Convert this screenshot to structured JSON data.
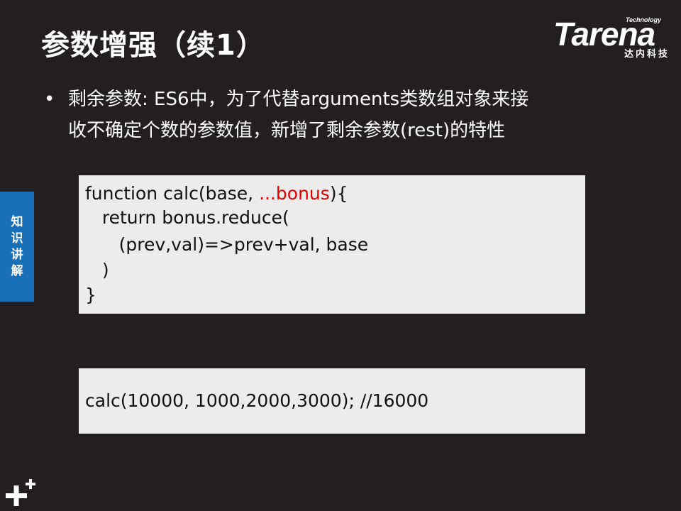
{
  "slide": {
    "title": "参数增强（续1）",
    "bullet": {
      "marker": "•",
      "line1": "剩余参数: ES6中，为了代替arguments类数组对象来接",
      "line2": "收不确定个数的参数值，新增了剩余参数(rest)的特性"
    }
  },
  "logo": {
    "technology": "Technology",
    "brand": "Tarena",
    "subtitle": "达内科技"
  },
  "side_tab": {
    "chars": [
      "知",
      "识",
      "讲",
      "解"
    ]
  },
  "code": {
    "line1_prefix": "function calc(base, ",
    "line1_highlight": "...bonus",
    "line1_suffix": "){",
    "line2": "   return bonus.reduce(",
    "line3": "      (prev,val)=>prev+val, base",
    "line4": "   )",
    "line5": "}"
  },
  "call_example": "calc(10000, 1000,2000,3000); //16000",
  "colors": {
    "background": "#231f20",
    "side_tab": "#1a70b8",
    "code_bg": "#ececec",
    "highlight": "#e00000"
  },
  "icons": {
    "footer": "plus-plus-icon"
  }
}
